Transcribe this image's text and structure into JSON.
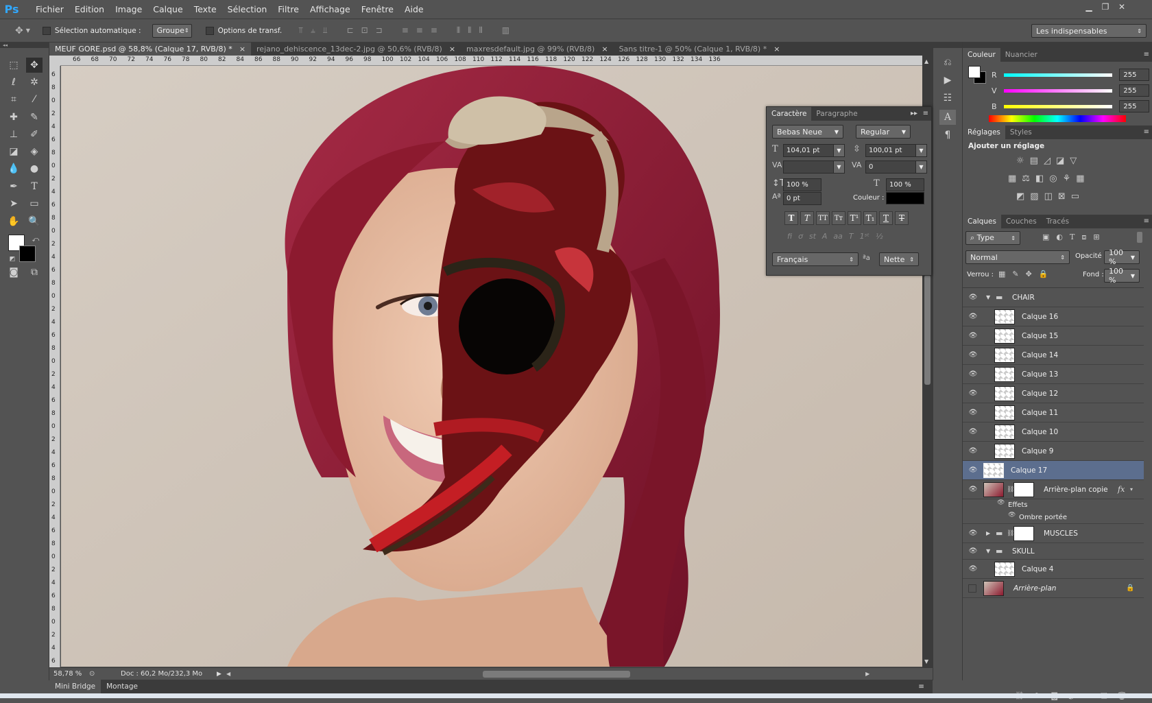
{
  "app": {
    "logo": "Ps"
  },
  "menu": [
    "Fichier",
    "Edition",
    "Image",
    "Calque",
    "Texte",
    "Sélection",
    "Filtre",
    "Affichage",
    "Fenêtre",
    "Aide"
  ],
  "options": {
    "auto_select_label": "Sélection automatique :",
    "auto_select_value": "Groupe",
    "transform_label": "Options de transf.",
    "workspace": "Les indispensables"
  },
  "tabs": [
    {
      "label": "MEUF GORE.psd @ 58,8% (Calque 17, RVB/8) *",
      "active": true
    },
    {
      "label": "rejano_dehiscence_13dec-2.jpg @ 50,6% (RVB/8)",
      "active": false
    },
    {
      "label": "maxresdefault.jpg @ 99% (RVB/8)",
      "active": false
    },
    {
      "label": "Sans titre-1 @ 50% (Calque 1, RVB/8) *",
      "active": false
    }
  ],
  "ruler_h": [
    "66",
    "68",
    "70",
    "72",
    "74",
    "76",
    "78",
    "80",
    "82",
    "84",
    "86",
    "88",
    "90",
    "92",
    "94",
    "96",
    "98",
    "100",
    "102",
    "104",
    "106",
    "108",
    "110",
    "112",
    "114",
    "116",
    "118",
    "120",
    "122",
    "124",
    "126",
    "128",
    "130",
    "132",
    "134",
    "136"
  ],
  "ruler_v": [
    "6",
    "8",
    "0",
    "2",
    "4",
    "6",
    "8",
    "0",
    "2",
    "4",
    "6",
    "8",
    "0",
    "2",
    "4",
    "6",
    "8",
    "0",
    "2",
    "4",
    "6",
    "8",
    "0",
    "2",
    "4",
    "6",
    "8",
    "0",
    "2",
    "4",
    "6",
    "8",
    "0",
    "2",
    "4",
    "6",
    "8",
    "0",
    "2",
    "4",
    "6",
    "8",
    "0",
    "2",
    "4",
    "6",
    "8"
  ],
  "status": {
    "zoom": "58,78 %",
    "doc": "Doc : 60,2 Mo/232,3 Mo"
  },
  "bridge": [
    "Mini Bridge",
    "Montage"
  ],
  "color_panel": {
    "tabs": [
      "Couleur",
      "Nuancier"
    ],
    "r_label": "R",
    "r_value": "255",
    "g_label": "V",
    "g_value": "255",
    "b_label": "B",
    "b_value": "255"
  },
  "adjust_panel": {
    "tabs": [
      "Réglages",
      "Styles"
    ],
    "title": "Ajouter un réglage"
  },
  "layers_panel": {
    "tabs": [
      "Calques",
      "Couches",
      "Tracés"
    ],
    "filter": "Type",
    "blend": "Normal",
    "opacity_label": "Opacité :",
    "opacity": "100 %",
    "lock_label": "Verrou :",
    "fill_label": "Fond :",
    "fill": "100 %",
    "group_chair": "CHAIR",
    "layers_chair": [
      "Calque 16",
      "Calque 15",
      "Calque 14",
      "Calque 13",
      "Calque 12",
      "Calque 11",
      "Calque 10",
      "Calque 9"
    ],
    "selected": "Calque 17",
    "bg_copy": "Arrière-plan copie",
    "effects": "Effets",
    "drop_shadow": "Ombre portée",
    "group_muscles": "MUSCLES",
    "group_skull": "SKULL",
    "layer_skull": "Calque 4",
    "background": "Arrière-plan",
    "fx": "fx"
  },
  "char_panel": {
    "tabs": [
      "Caractère",
      "Paragraphe"
    ],
    "font": "Bebas Neue",
    "style": "Regular",
    "size": "104,01 pt",
    "leading": "100,01 pt",
    "kerning": "",
    "tracking": "0",
    "vscale": "100 %",
    "hscale": "100 %",
    "baseline": "0 pt",
    "color_label": "Couleur :",
    "language": "Français",
    "aa_label": "a",
    "antialias": "Nette"
  },
  "colors": {
    "hair": "#8c1a2f",
    "bg": "#cfc4b8",
    "skin": "#e5b99f",
    "gore": "#8a1216",
    "bone": "#b9a58b",
    "selection": "#5c6e8e"
  }
}
